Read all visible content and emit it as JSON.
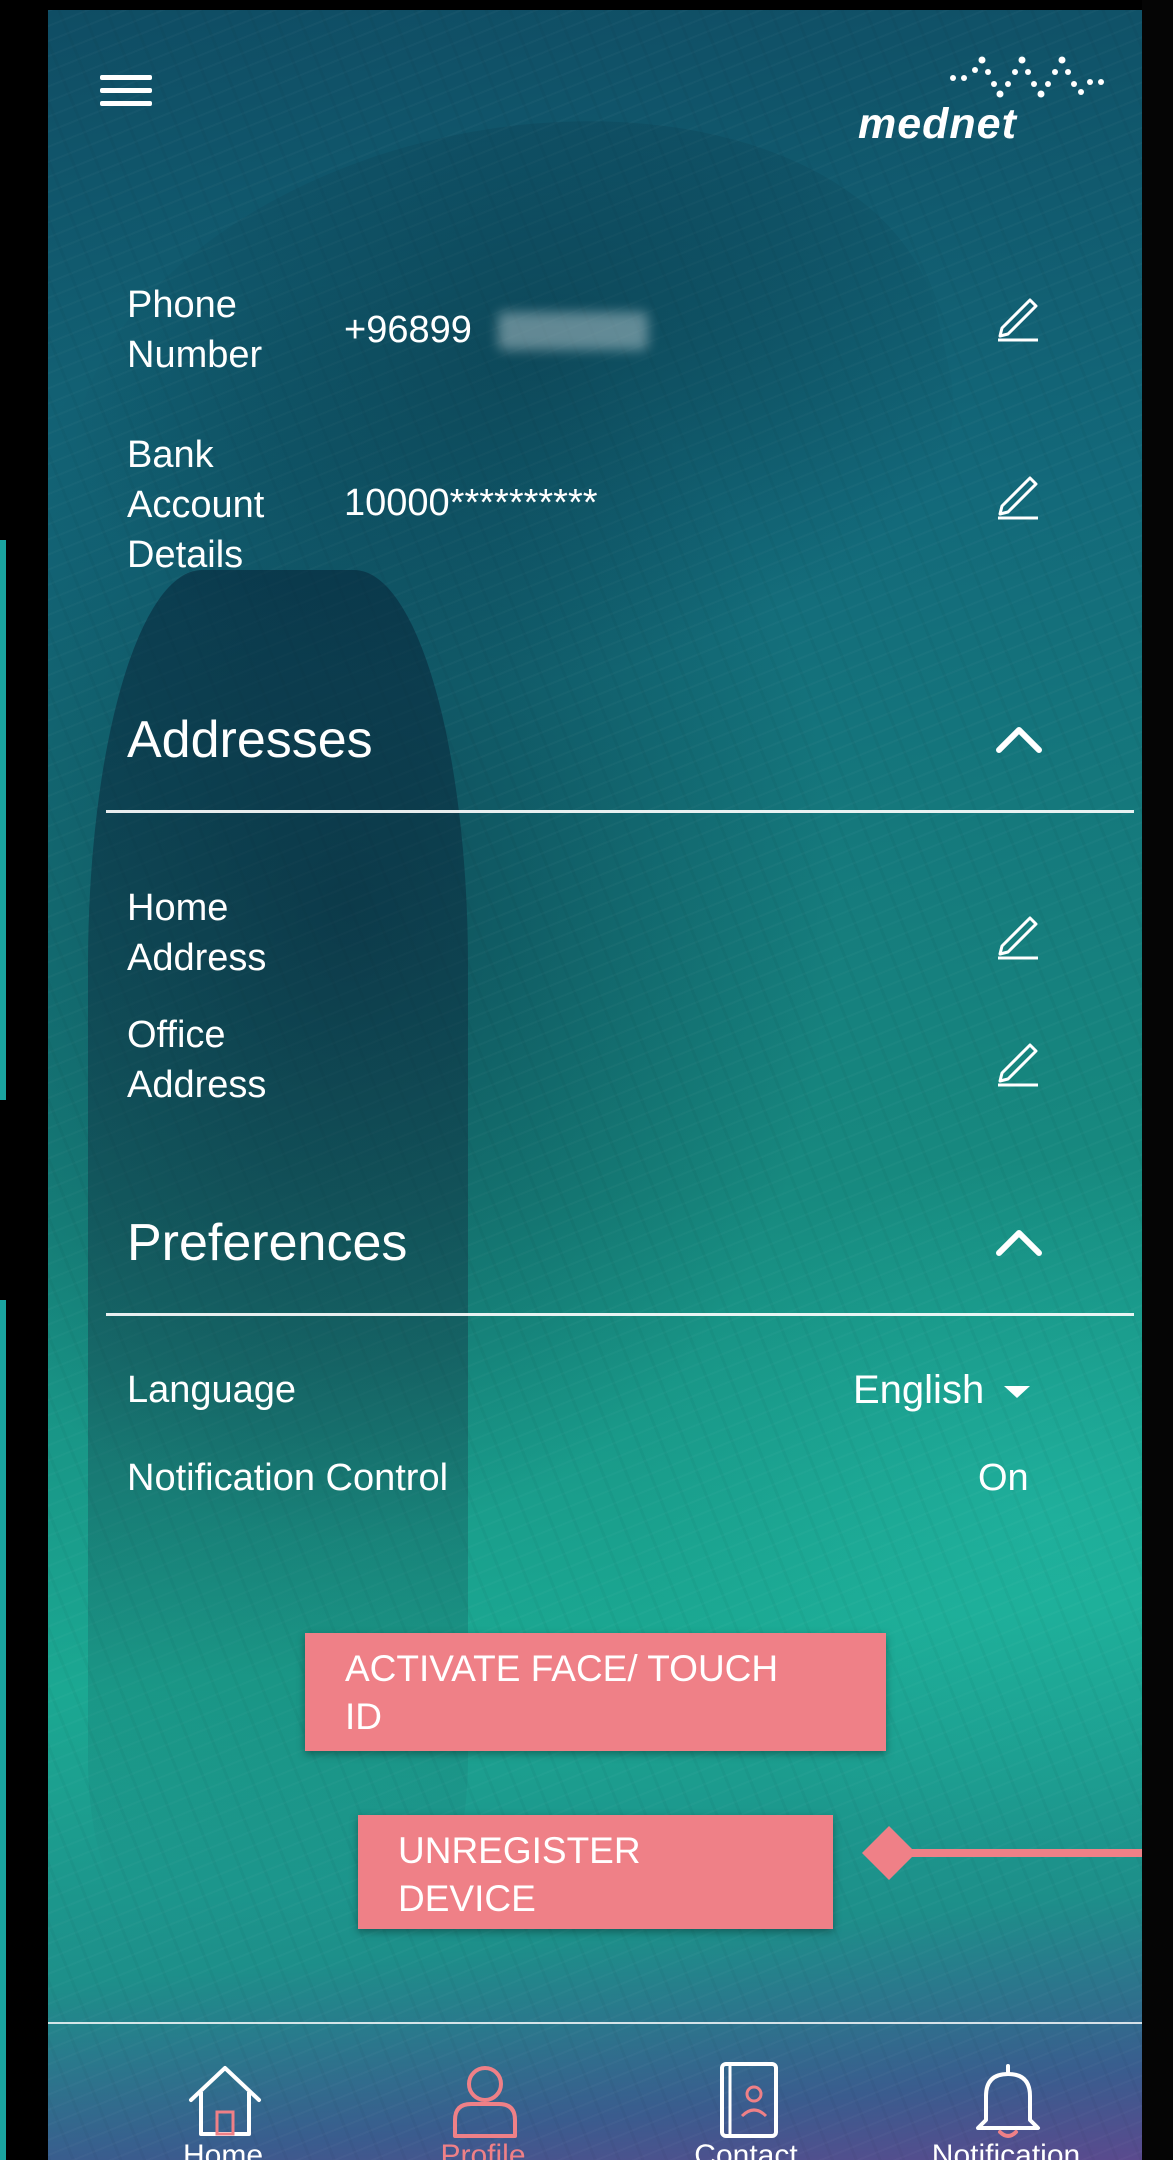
{
  "header": {
    "menu_icon": "hamburger-menu-icon",
    "logo_text": "mednet"
  },
  "contact": {
    "phone_label": "Phone\nNumber",
    "phone_value": "+96899",
    "bank_label": "Bank\nAccount\nDetails",
    "bank_value": "10000**********"
  },
  "addresses": {
    "title": "Addresses",
    "home_label": "Home\nAddress",
    "office_label": "Office\nAddress"
  },
  "preferences": {
    "title": "Preferences",
    "language_label": "Language",
    "language_value": "English",
    "notification_label": "Notification Control",
    "notification_value": "On"
  },
  "actions": {
    "activate_face_touch_id": "ACTIVATE FACE/ TOUCH\nID",
    "unregister_device": "UNREGISTER\nDEVICE"
  },
  "bottom_nav": {
    "items": [
      {
        "label": "Home",
        "icon": "home-icon",
        "active": false
      },
      {
        "label": "Profile",
        "icon": "profile-icon",
        "active": true
      },
      {
        "label": "Contact",
        "icon": "contact-book-icon",
        "active": false
      },
      {
        "label": "Notification",
        "icon": "bell-icon",
        "active": false
      }
    ]
  },
  "colors": {
    "button_pink": "#ef8087",
    "active_nav": "#ef8087",
    "gradient_top": "#0f4d64",
    "gradient_bottom": "#1ba892"
  }
}
